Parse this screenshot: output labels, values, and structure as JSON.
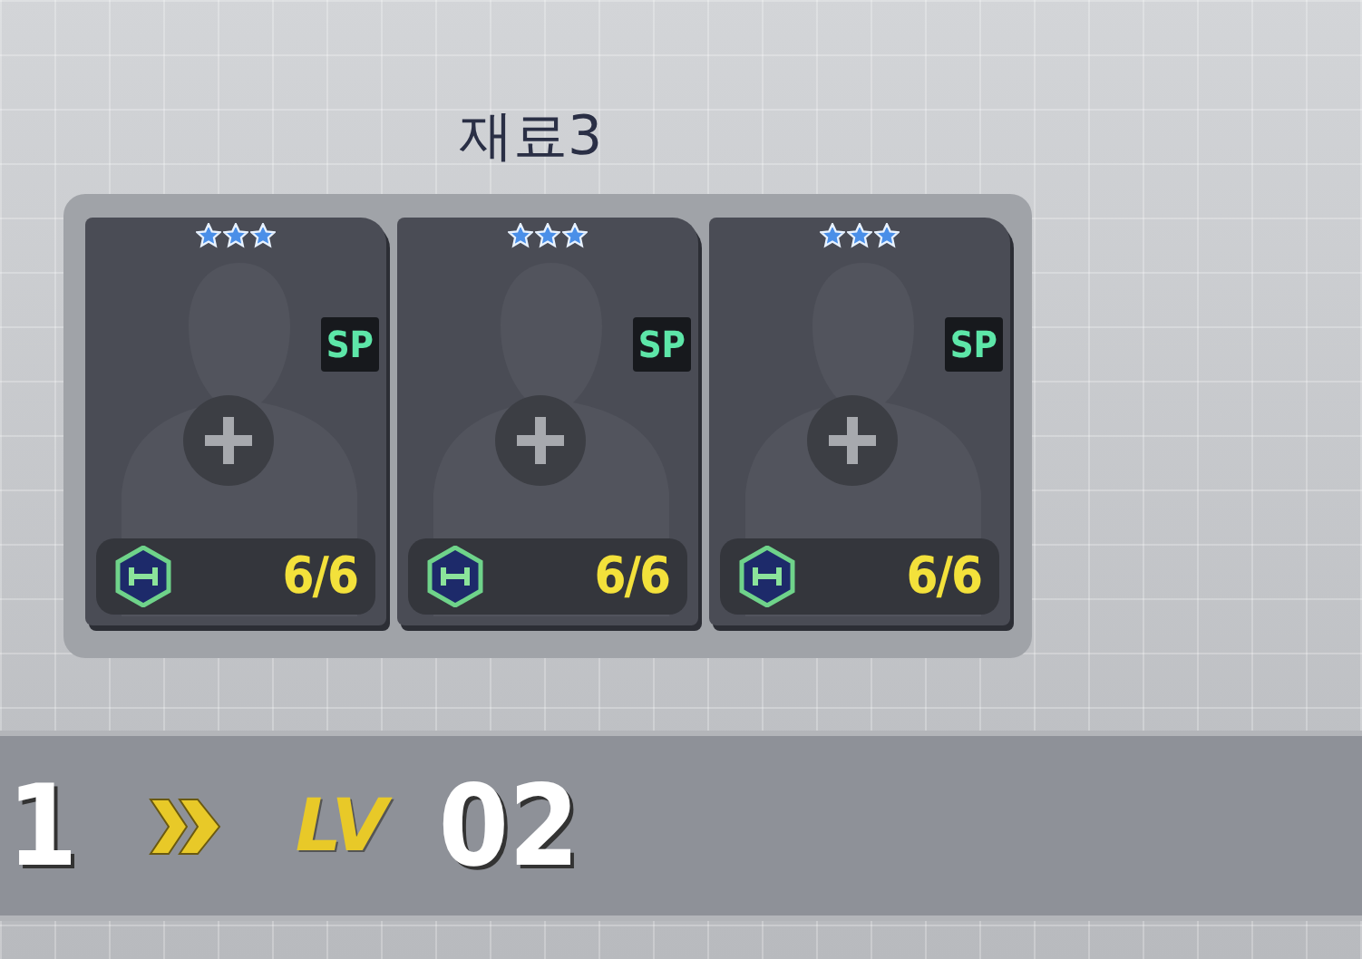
{
  "title": "재료3",
  "slots": [
    {
      "stars": 3,
      "badge": "SP",
      "count": "6/6"
    },
    {
      "stars": 3,
      "badge": "SP",
      "count": "6/6"
    },
    {
      "stars": 3,
      "badge": "SP",
      "count": "6/6"
    }
  ],
  "level_bar": {
    "from": "1",
    "label": "LV",
    "to": "02"
  }
}
